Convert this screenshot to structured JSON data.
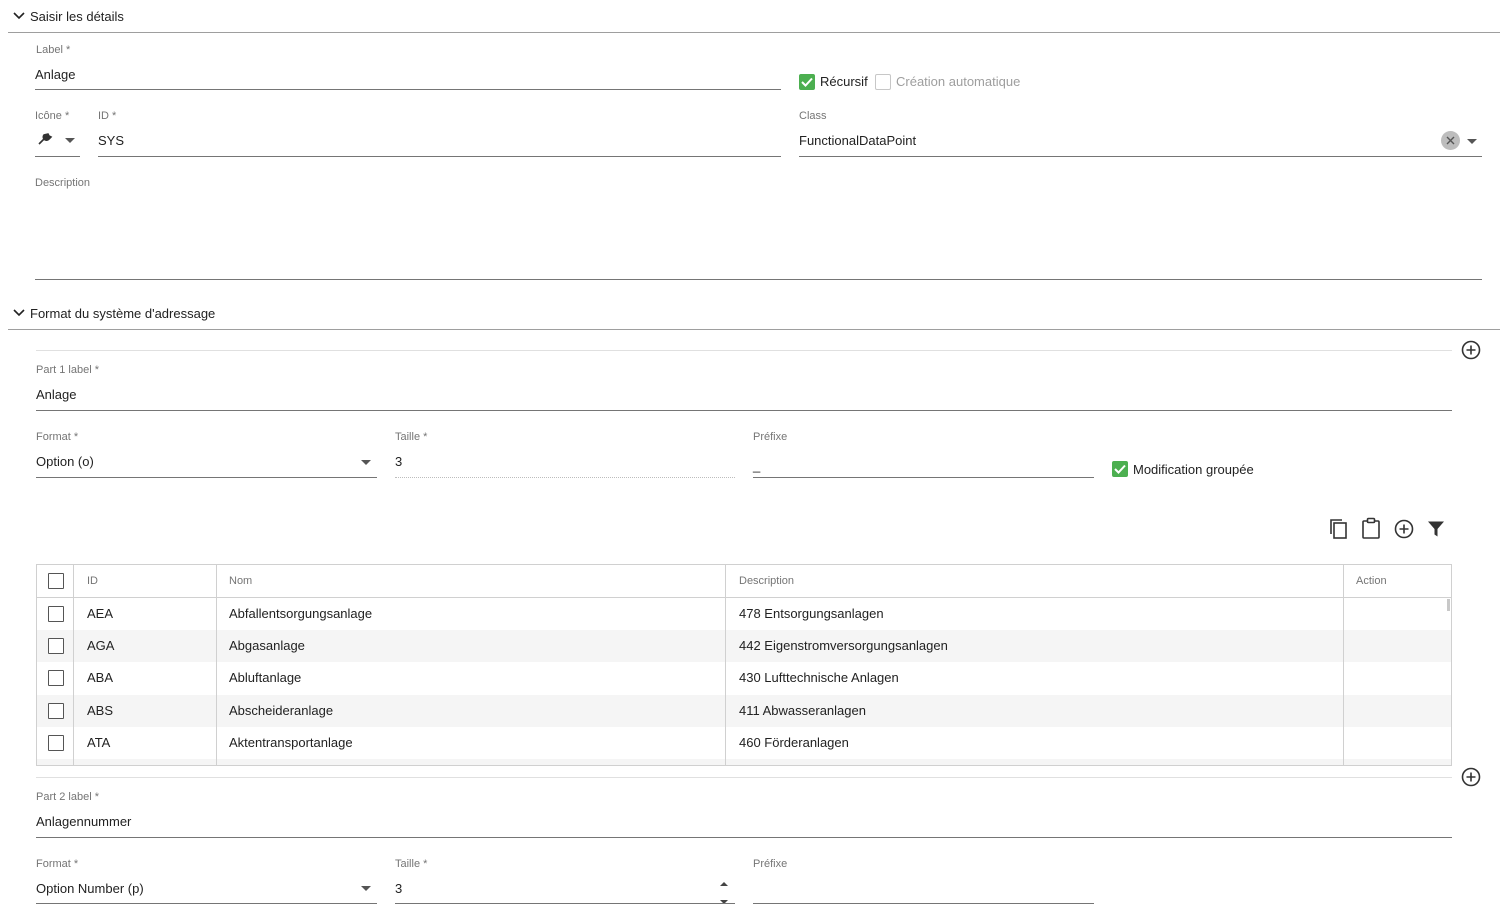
{
  "section1": {
    "title": "Saisir les détails"
  },
  "label_field": {
    "label": "Label *",
    "value": "Anlage"
  },
  "recursive": {
    "label": "Récursif",
    "checked": true
  },
  "auto_create": {
    "label": "Création automatique",
    "checked": false
  },
  "icon_field": {
    "label": "Icône *"
  },
  "id_field": {
    "label": "ID *",
    "value": "SYS"
  },
  "class_field": {
    "label": "Class",
    "value": "FunctionalDataPoint"
  },
  "description_field": {
    "label": "Description",
    "value": ""
  },
  "section2": {
    "title": "Format du système d'adressage"
  },
  "part1": {
    "label": "Part 1 label *",
    "value": "Anlage",
    "format_label": "Format *",
    "format_value": "Option (o)",
    "size_label": "Taille *",
    "size_value": "3",
    "prefix_label": "Préfixe",
    "prefix_value": "_",
    "bulk_edit": {
      "label": "Modification groupée",
      "checked": true
    }
  },
  "table": {
    "headers": [
      "ID",
      "Nom",
      "Description",
      "Action"
    ],
    "rows": [
      {
        "id": "AEA",
        "name": "Abfallentsorgungsanlage",
        "description": "478 Entsorgungsanlagen"
      },
      {
        "id": "AGA",
        "name": "Abgasanlage",
        "description": "442 Eigenstromversorgungsanlagen"
      },
      {
        "id": "ABA",
        "name": "Abluftanlage",
        "description": "430 Lufttechnische Anlagen"
      },
      {
        "id": "ABS",
        "name": "Abscheideranlage",
        "description": "411 Abwasseranlagen"
      },
      {
        "id": "ATA",
        "name": "Aktentransportanlage",
        "description": "460 Förderanlagen"
      }
    ]
  },
  "part2": {
    "label": "Part 2 label *",
    "value": "Anlagennummer",
    "format_label": "Format *",
    "format_value": "Option Number (p)",
    "size_label": "Taille *",
    "size_value": "3",
    "prefix_label": "Préfixe",
    "prefix_value": ""
  },
  "colors": {
    "accent_green": "#4caf50",
    "underline": "#757575",
    "row_alt": "#f5f5f5"
  }
}
